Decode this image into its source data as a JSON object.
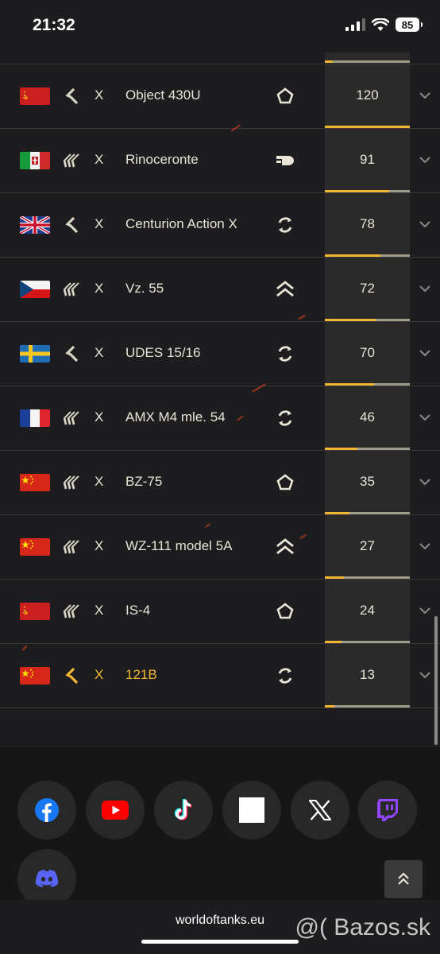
{
  "status_bar": {
    "time": "21:32",
    "battery": "85"
  },
  "vehicles": [
    {
      "flag": "ussr",
      "rank": 1,
      "tier": "X",
      "name": "Object 430U",
      "class": "mt",
      "score": "120",
      "progress": 1.0,
      "gold": false
    },
    {
      "flag": "italy",
      "rank": 3,
      "tier": "X",
      "name": "Rinoceronte",
      "class": "ht-auto",
      "score": "91",
      "progress": 0.76,
      "gold": false
    },
    {
      "flag": "uk",
      "rank": 1,
      "tier": "X",
      "name": "Centurion Action X",
      "class": "lt",
      "score": "78",
      "progress": 0.65,
      "gold": false
    },
    {
      "flag": "czech",
      "rank": 3,
      "tier": "X",
      "name": "Vz. 55",
      "class": "ht",
      "score": "72",
      "progress": 0.6,
      "gold": false
    },
    {
      "flag": "sweden",
      "rank": 1,
      "tier": "X",
      "name": "UDES 15/16",
      "class": "lt",
      "score": "70",
      "progress": 0.58,
      "gold": false
    },
    {
      "flag": "france",
      "rank": 3,
      "tier": "X",
      "name": "AMX M4 mle. 54",
      "class": "lt",
      "score": "46",
      "progress": 0.38,
      "gold": false
    },
    {
      "flag": "china",
      "rank": 3,
      "tier": "X",
      "name": "BZ-75",
      "class": "mt",
      "score": "35",
      "progress": 0.29,
      "gold": false
    },
    {
      "flag": "china",
      "rank": 3,
      "tier": "X",
      "name": "WZ-111 model 5A",
      "class": "ht",
      "score": "27",
      "progress": 0.22,
      "gold": false
    },
    {
      "flag": "ussr",
      "rank": 3,
      "tier": "X",
      "name": "IS-4",
      "class": "mt",
      "score": "24",
      "progress": 0.2,
      "gold": false
    },
    {
      "flag": "china",
      "rank": 1,
      "tier": "X",
      "name": "121B",
      "class": "lt",
      "score": "13",
      "progress": 0.11,
      "gold": true
    }
  ],
  "social": [
    "facebook-icon",
    "youtube-icon",
    "tiktok-icon",
    "square-icon",
    "x-icon",
    "twitch-icon",
    "discord-icon"
  ],
  "browser": {
    "url": "worldoftanks.eu"
  },
  "watermark": "@( Bazos.sk",
  "colors": {
    "accent": "#f2b632",
    "track": "#a09c8c"
  }
}
